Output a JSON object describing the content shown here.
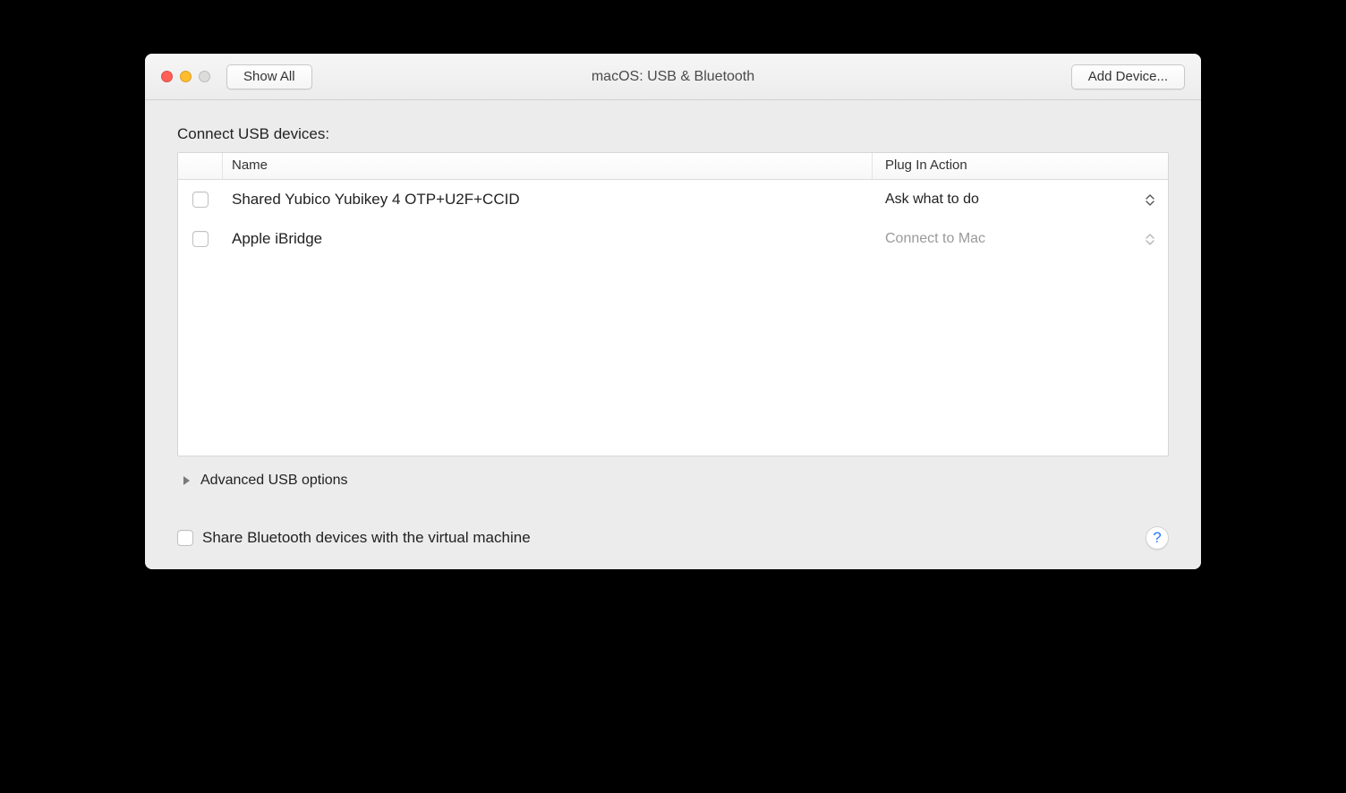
{
  "titlebar": {
    "show_all_label": "Show All",
    "window_title": "macOS: USB & Bluetooth",
    "add_device_label": "Add Device..."
  },
  "section_label": "Connect USB devices:",
  "table": {
    "columns": {
      "name": "Name",
      "plug_in_action": "Plug In Action"
    },
    "rows": [
      {
        "name": "Shared Yubico Yubikey 4 OTP+U2F+CCID",
        "action": "Ask what to do",
        "action_enabled": true
      },
      {
        "name": "Apple iBridge",
        "action": "Connect to Mac",
        "action_enabled": false
      }
    ]
  },
  "advanced_label": "Advanced USB options",
  "share_bt_label": "Share Bluetooth devices with the virtual machine",
  "help_label": "?"
}
